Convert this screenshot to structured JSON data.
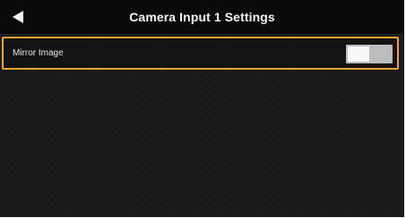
{
  "header": {
    "title": "Camera Input 1 Settings",
    "back_icon": "back-arrow-icon"
  },
  "settings": {
    "mirror_image": {
      "label": "Mirror Image",
      "state": "off"
    }
  },
  "colors": {
    "highlight_border": "#f0a233",
    "background": "#121212",
    "toggle_track": "#bdbdbd",
    "toggle_knob": "#f8f8f8"
  }
}
